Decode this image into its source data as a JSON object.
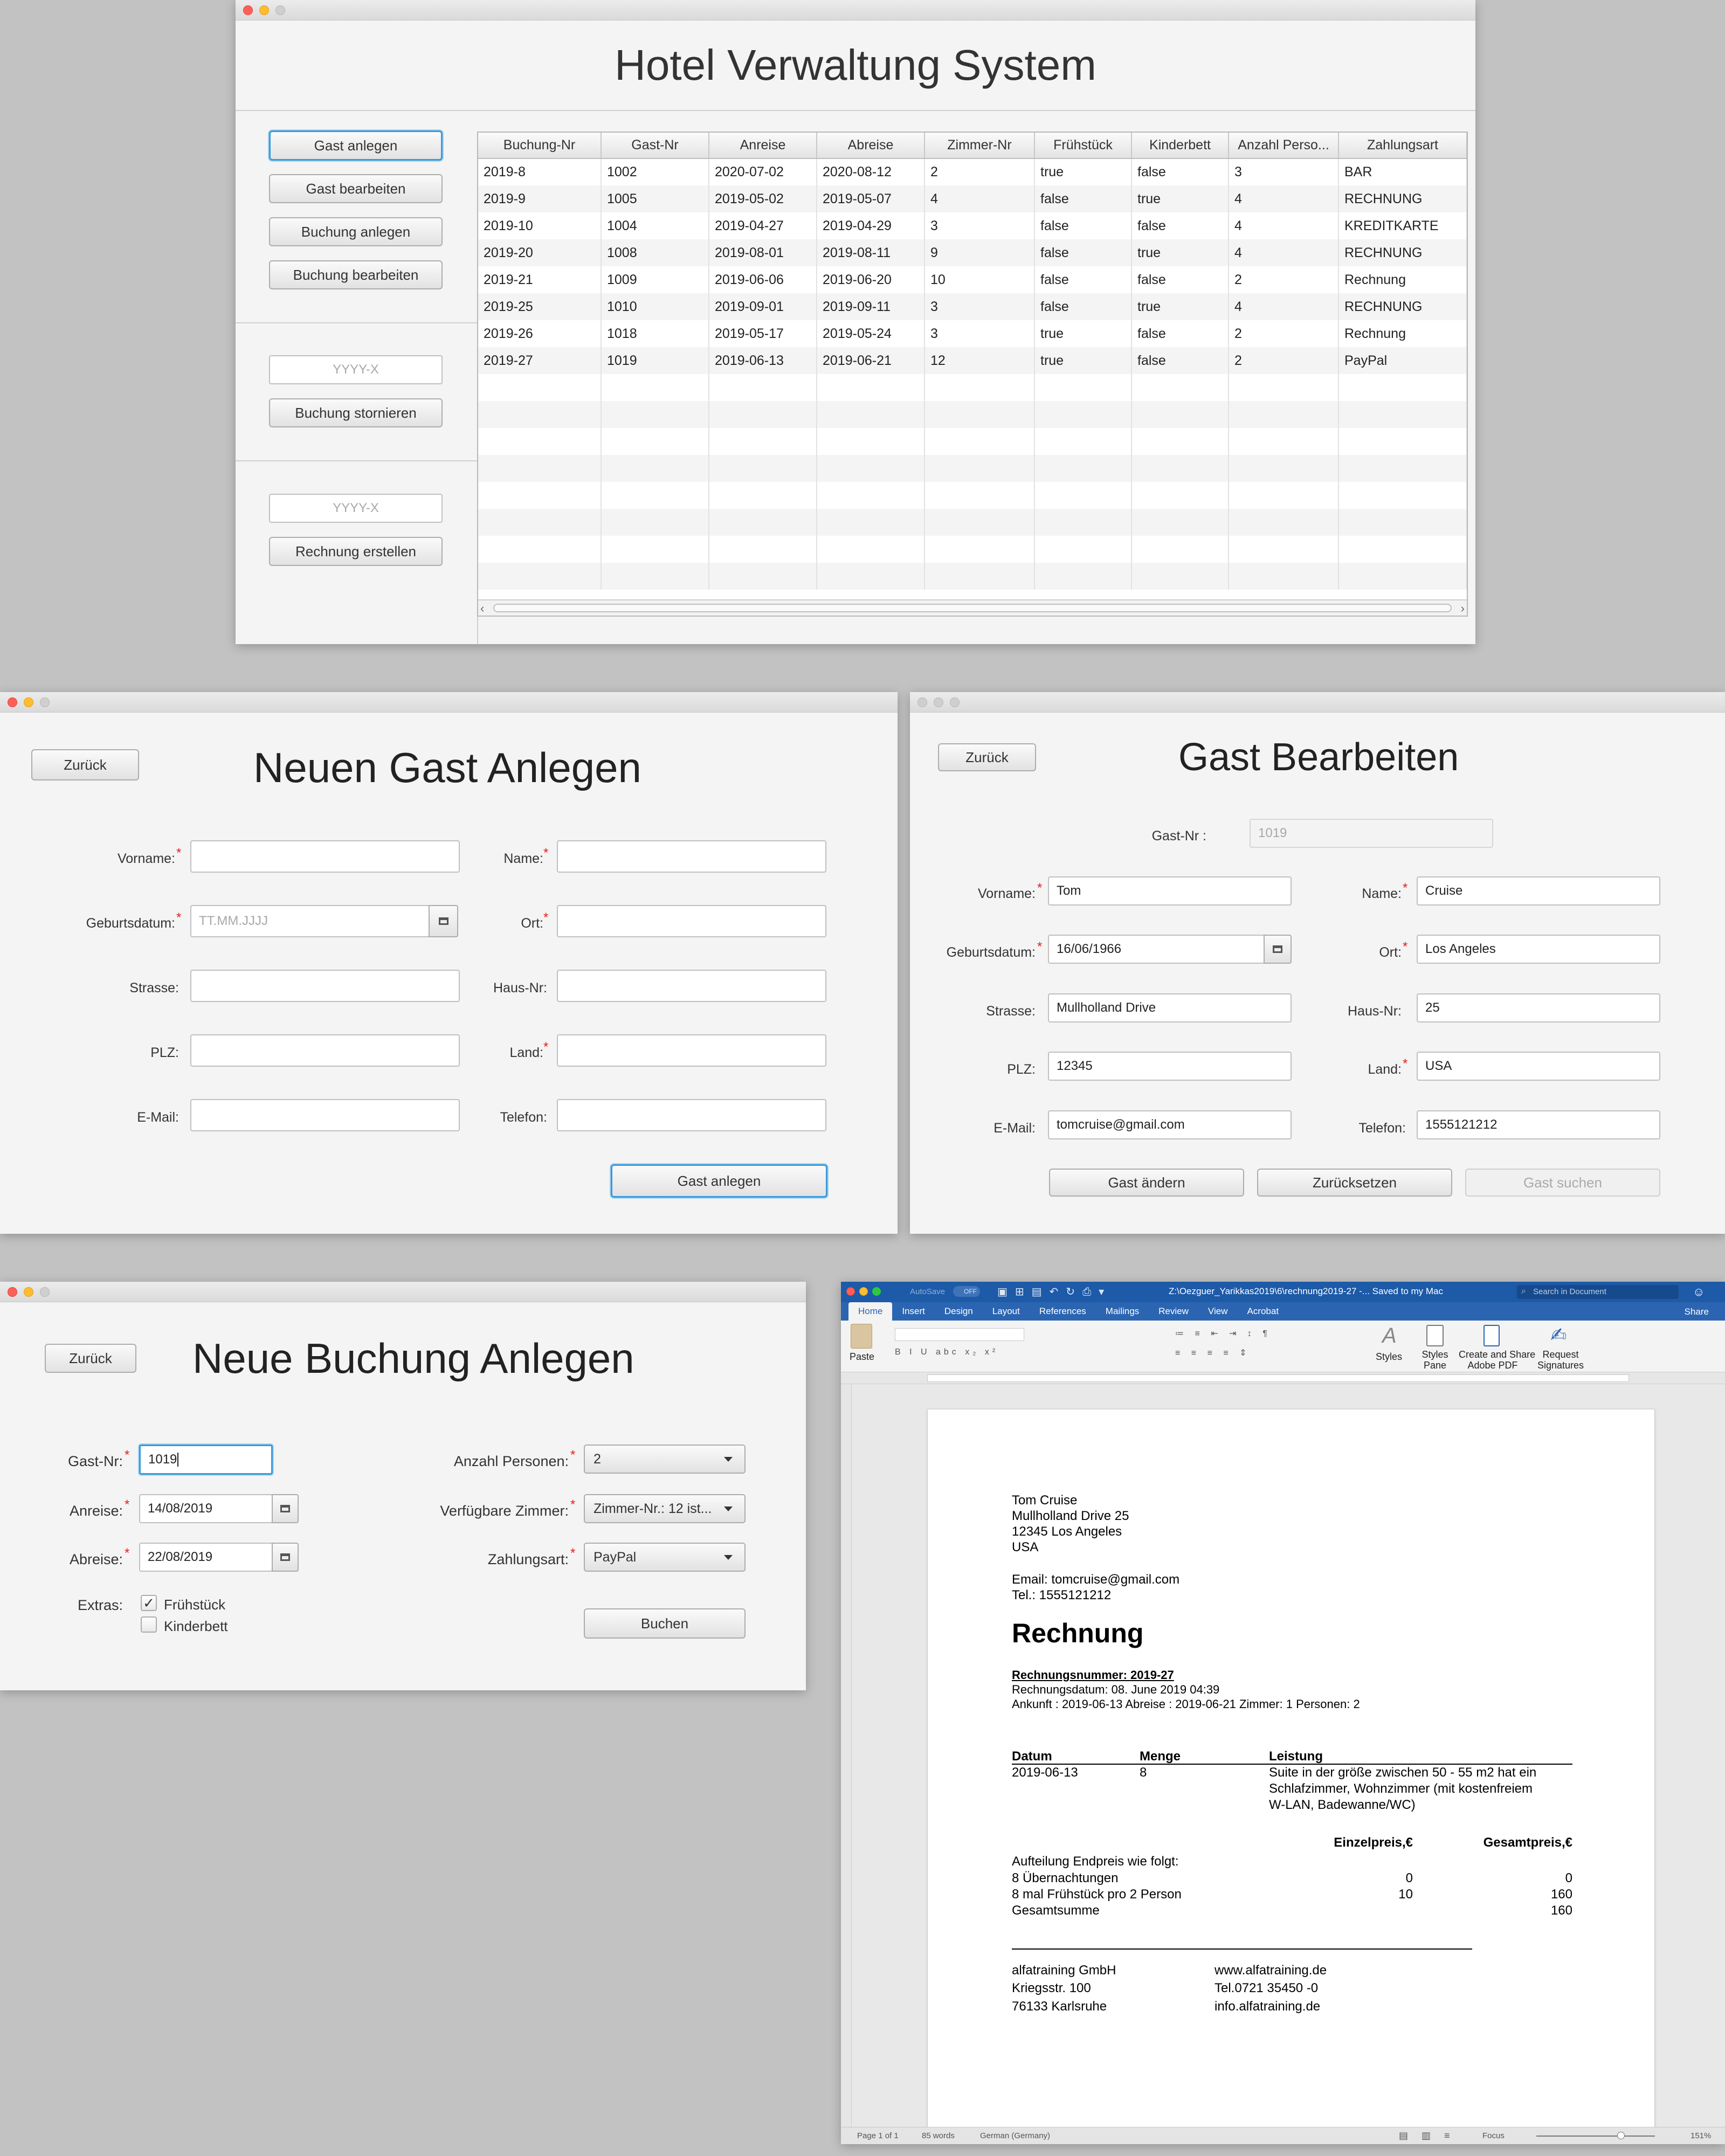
{
  "main_window": {
    "title": "Hotel Verwaltung System",
    "buttons": {
      "gast_anlegen": "Gast anlegen",
      "gast_bearbeiten": "Gast bearbeiten",
      "buchung_anlegen": "Buchung anlegen",
      "buchung_bearbeiten": "Buchung bearbeiten",
      "buchung_stornieren": "Buchung stornieren",
      "rechnung_erstellen": "Rechnung erstellen"
    },
    "storno_input_placeholder": "YYYY-X",
    "rechnung_input_placeholder": "YYYY-X",
    "table": {
      "columns": [
        "Buchung-Nr",
        "Gast-Nr",
        "Anreise",
        "Abreise",
        "Zimmer-Nr",
        "Frühstück",
        "Kinderbett",
        "Anzahl Perso...",
        "Zahlungsart"
      ],
      "rows": [
        [
          "2019-8",
          "1002",
          "2020-07-02",
          "2020-08-12",
          "2",
          "true",
          "false",
          "3",
          "BAR"
        ],
        [
          "2019-9",
          "1005",
          "2019-05-02",
          "2019-05-07",
          "4",
          "false",
          "true",
          "4",
          "RECHNUNG"
        ],
        [
          "2019-10",
          "1004",
          "2019-04-27",
          "2019-04-29",
          "3",
          "false",
          "false",
          "4",
          "KREDITKARTE"
        ],
        [
          "2019-20",
          "1008",
          "2019-08-01",
          "2019-08-11",
          "9",
          "false",
          "true",
          "4",
          "RECHNUNG"
        ],
        [
          "2019-21",
          "1009",
          "2019-06-06",
          "2019-06-20",
          "10",
          "false",
          "false",
          "2",
          "Rechnung"
        ],
        [
          "2019-25",
          "1010",
          "2019-09-01",
          "2019-09-11",
          "3",
          "false",
          "true",
          "4",
          "RECHNUNG"
        ],
        [
          "2019-26",
          "1018",
          "2019-05-17",
          "2019-05-24",
          "3",
          "true",
          "false",
          "2",
          "Rechnung"
        ],
        [
          "2019-27",
          "1019",
          "2019-06-13",
          "2019-06-21",
          "12",
          "true",
          "false",
          "2",
          "PayPal"
        ]
      ]
    }
  },
  "neuer_gast": {
    "title": "Neuen Gast Anlegen",
    "back": "Zurück",
    "labels": {
      "vorname": "Vorname:",
      "name": "Name:",
      "geburtsdatum": "Geburtsdatum:",
      "ort": "Ort:",
      "strasse": "Strasse:",
      "hausnr": "Haus-Nr:",
      "plz": "PLZ:",
      "land": "Land:",
      "email": "E-Mail:",
      "telefon": "Telefon:"
    },
    "date_placeholder": "TT.MM.JJJJ",
    "submit": "Gast anlegen"
  },
  "gast_bearbeiten": {
    "title": "Gast Bearbeiten",
    "back": "Zurück",
    "labels": {
      "gastnr": "Gast-Nr :",
      "vorname": "Vorname:",
      "name": "Name:",
      "geburtsdatum": "Geburtsdatum:",
      "ort": "Ort:",
      "strasse": "Strasse:",
      "hausnr": "Haus-Nr:",
      "plz": "PLZ:",
      "land": "Land:",
      "email": "E-Mail:",
      "telefon": "Telefon:"
    },
    "values": {
      "gastnr": "1019",
      "vorname": "Tom",
      "name": "Cruise",
      "geburtsdatum": "16/06/1966",
      "ort": "Los Angeles",
      "strasse": "Mullholland Drive",
      "hausnr": "25",
      "plz": "12345",
      "land": "USA",
      "email": "tomcruise@gmail.com",
      "telefon": "1555121212"
    },
    "buttons": {
      "aendern": "Gast ändern",
      "reset": "Zurücksetzen",
      "suchen": "Gast suchen"
    }
  },
  "neue_buchung": {
    "title": "Neue Buchung Anlegen",
    "back": "Zurück",
    "labels": {
      "gastnr": "Gast-Nr:",
      "anreise": "Anreise:",
      "abreise": "Abreise:",
      "extras": "Extras:",
      "personen": "Anzahl Personen:",
      "zimmer": "Verfügbare Zimmer:",
      "zahlungsart": "Zahlungsart:"
    },
    "values": {
      "gastnr": "1019",
      "anreise": "14/08/2019",
      "abreise": "22/08/2019",
      "personen": "2",
      "zimmer": "Zimmer-Nr.: 12 ist...",
      "zahlungsart": "PayPal"
    },
    "extras": {
      "fruehstueck": "Frühstück",
      "kinderbett": "Kinderbett",
      "fruehstueck_checked": "✓"
    },
    "submit": "Buchen"
  },
  "word": {
    "toolbar": {
      "autosave": "AutoSave",
      "off": "OFF",
      "title": "Z:\\Oezguer_Yarikkas2019\\6\\rechnung2019-27  -... Saved to my Mac",
      "search": "Search in Document"
    },
    "tabs": [
      "Home",
      "Insert",
      "Design",
      "Layout",
      "References",
      "Mailings",
      "Review",
      "View",
      "Acrobat"
    ],
    "share": "Share",
    "ribbon": {
      "paste": "Paste",
      "styles": "Styles",
      "styles_pane": "Styles\nPane",
      "create_pdf": "Create and Share\nAdobe PDF",
      "request_sig": "Request\nSignatures"
    },
    "status": {
      "page": "Page 1 of 1",
      "words": "85 words",
      "language": "German (Germany)",
      "focus": "Focus",
      "zoom": "151%"
    },
    "doc": {
      "addr": [
        "Tom Cruise",
        "Mullholland Drive 25",
        "12345 Los Angeles",
        "USA"
      ],
      "email": "Email:  tomcruise@gmail.com",
      "tel": "Tel.: 1555121212",
      "heading": "Rechnung",
      "nr": "Rechnungsnummer: 2019-27",
      "datum": "Rechnungsdatum: 08. June 2019 04:39",
      "ankunft": "Ankunft : 2019-06-13  Abreise : 2019-06-21 Zimmer: 1  Personen: 2",
      "col_datum": "Datum",
      "col_menge": "Menge",
      "col_leistung": "Leistung",
      "row_datum": "2019-06-13",
      "row_menge": "8",
      "leistung": [
        "Suite  in der größe zwischen 50 - 55 m2 hat ein",
        "Schlafzimmer, Wohnzimmer (mit kostenfreiem",
        "W-LAN, Badewanne/WC)"
      ],
      "einzelpreis": "Einzelpreis,€",
      "gesamtpreis": "Gesamtpreis,€",
      "aufteilung": "Aufteilung Endpreis wie folgt:",
      "l1": "8 Übernachtungen",
      "l1e": "0",
      "l1g": "0",
      "l2": "8 mal Frühstück  pro 2 Person",
      "l2e": "10",
      "l2g": "160",
      "l3": "Gesamtsumme",
      "l3g": "160",
      "footer_left": [
        "alfatraining GmbH",
        "Kriegsstr. 100",
        "76133 Karlsruhe"
      ],
      "footer_right": [
        "www.alfatraining.de",
        "Tel.0721 35450 -0",
        "info.alfatraining.de"
      ]
    }
  }
}
